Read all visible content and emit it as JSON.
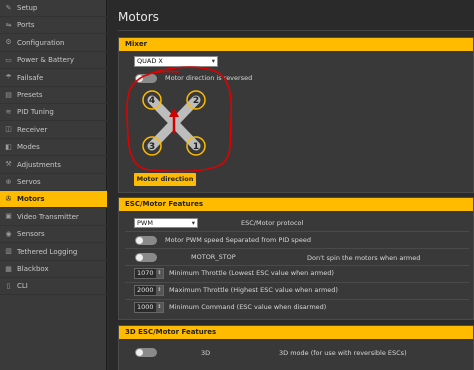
{
  "sidebar": {
    "items": [
      {
        "label": "Setup",
        "icon": "wrench-icon",
        "glyph": "✎"
      },
      {
        "label": "Ports",
        "icon": "plug-icon",
        "glyph": "⇋"
      },
      {
        "label": "Configuration",
        "icon": "gear-icon",
        "glyph": "⚙"
      },
      {
        "label": "Power & Battery",
        "icon": "battery-icon",
        "glyph": "▭"
      },
      {
        "label": "Failsafe",
        "icon": "parachute-icon",
        "glyph": "☂"
      },
      {
        "label": "Presets",
        "icon": "presets-icon",
        "glyph": "▤"
      },
      {
        "label": "PID Tuning",
        "icon": "tuning-icon",
        "glyph": "≋"
      },
      {
        "label": "Receiver",
        "icon": "receiver-icon",
        "glyph": "◫"
      },
      {
        "label": "Modes",
        "icon": "modes-icon",
        "glyph": "◧"
      },
      {
        "label": "Adjustments",
        "icon": "adjustments-icon",
        "glyph": "⚒"
      },
      {
        "label": "Servos",
        "icon": "servo-icon",
        "glyph": "⊕"
      },
      {
        "label": "Motors",
        "icon": "motor-icon",
        "glyph": "✇"
      },
      {
        "label": "Video Transmitter",
        "icon": "vtx-icon",
        "glyph": "▣"
      },
      {
        "label": "Sensors",
        "icon": "sensors-icon",
        "glyph": "◉"
      },
      {
        "label": "Tethered Logging",
        "icon": "logging-icon",
        "glyph": "▥"
      },
      {
        "label": "Blackbox",
        "icon": "blackbox-icon",
        "glyph": "▦"
      },
      {
        "label": "CLI",
        "icon": "cli-icon",
        "glyph": "▯"
      }
    ],
    "active_index": 11
  },
  "main": {
    "title": "Motors",
    "mixer": {
      "header": "Mixer",
      "selected": "QUAD X",
      "motor_direction_reversed_label": "Motor direction is reversed",
      "motor_direction_reversed": false,
      "motor_numbers": [
        "4",
        "2",
        "3",
        "1"
      ],
      "button_label": "Motor direction"
    },
    "esc": {
      "header": "ESC/Motor Features",
      "protocol_value": "PWM",
      "protocol_label": "ESC/Motor protocol",
      "separate_pwm_label": "Motor PWM speed Separated from PID speed",
      "motor_stop_label": "MOTOR_STOP",
      "motor_stop_desc": "Don't spin the motors when armed",
      "min_throttle_value": "1070",
      "min_throttle_label": "Minimum Throttle (Lowest ESC value when armed)",
      "max_throttle_value": "2000",
      "max_throttle_label": "Maximum Throttle (Highest ESC value when armed)",
      "min_command_value": "1000",
      "min_command_label": "Minimum Command (ESC value when disarmed)"
    },
    "esc3d": {
      "header": "3D ESC/Motor Features",
      "label": "3D",
      "desc": "3D mode (for use with reversible ESCs)"
    }
  },
  "colors": {
    "accent": "#ffbb00",
    "annotation": "#e00000"
  }
}
